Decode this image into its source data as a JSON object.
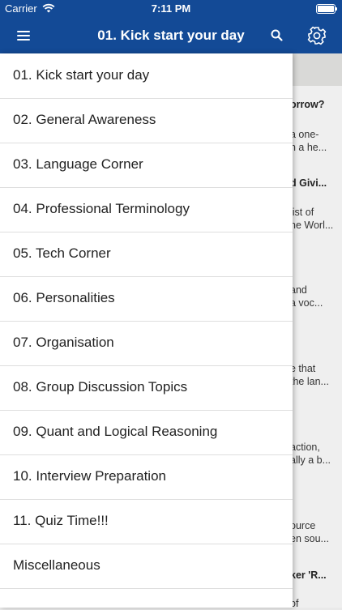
{
  "status_bar": {
    "carrier": "Carrier",
    "time": "7:11 PM"
  },
  "nav_bar": {
    "title": "01. Kick start your day",
    "icons": {
      "menu": "hamburger-icon",
      "search": "search-icon",
      "settings": "gear-icon"
    }
  },
  "drawer": {
    "items": [
      {
        "label": "01. Kick start your day"
      },
      {
        "label": "02. General Awareness"
      },
      {
        "label": "03. Language Corner"
      },
      {
        "label": "04. Professional Terminology"
      },
      {
        "label": "05. Tech Corner"
      },
      {
        "label": "06. Personalities"
      },
      {
        "label": "07. Organisation"
      },
      {
        "label": "08. Group Discussion Topics"
      },
      {
        "label": "09. Quant and Logical Reasoning"
      },
      {
        "label": "10. Interview Preparation"
      },
      {
        "label": "11. Quiz Time!!!"
      },
      {
        "label": "Miscellaneous"
      }
    ]
  },
  "background_cards": [
    {
      "title": "orrow?",
      "line1": "a one-",
      "line2": "n a he..."
    },
    {
      "title": "d Givi...",
      "line1": "list of",
      "line2": "ne Worl..."
    },
    {
      "title": "",
      "line1": "and",
      "line2": "a voc..."
    },
    {
      "title": "",
      "line1": "e that",
      "line2": "the lan..."
    },
    {
      "title": "",
      "line1": "action,",
      "line2": "ally a b..."
    },
    {
      "title": "",
      "line1": "ource",
      "line2": "en sou..."
    },
    {
      "title": "ker 'R...",
      "line1": "of",
      "line2": ""
    }
  ],
  "colors": {
    "brand": "#134a96",
    "drawer_bg": "#ffffff",
    "divider": "#dedede"
  }
}
